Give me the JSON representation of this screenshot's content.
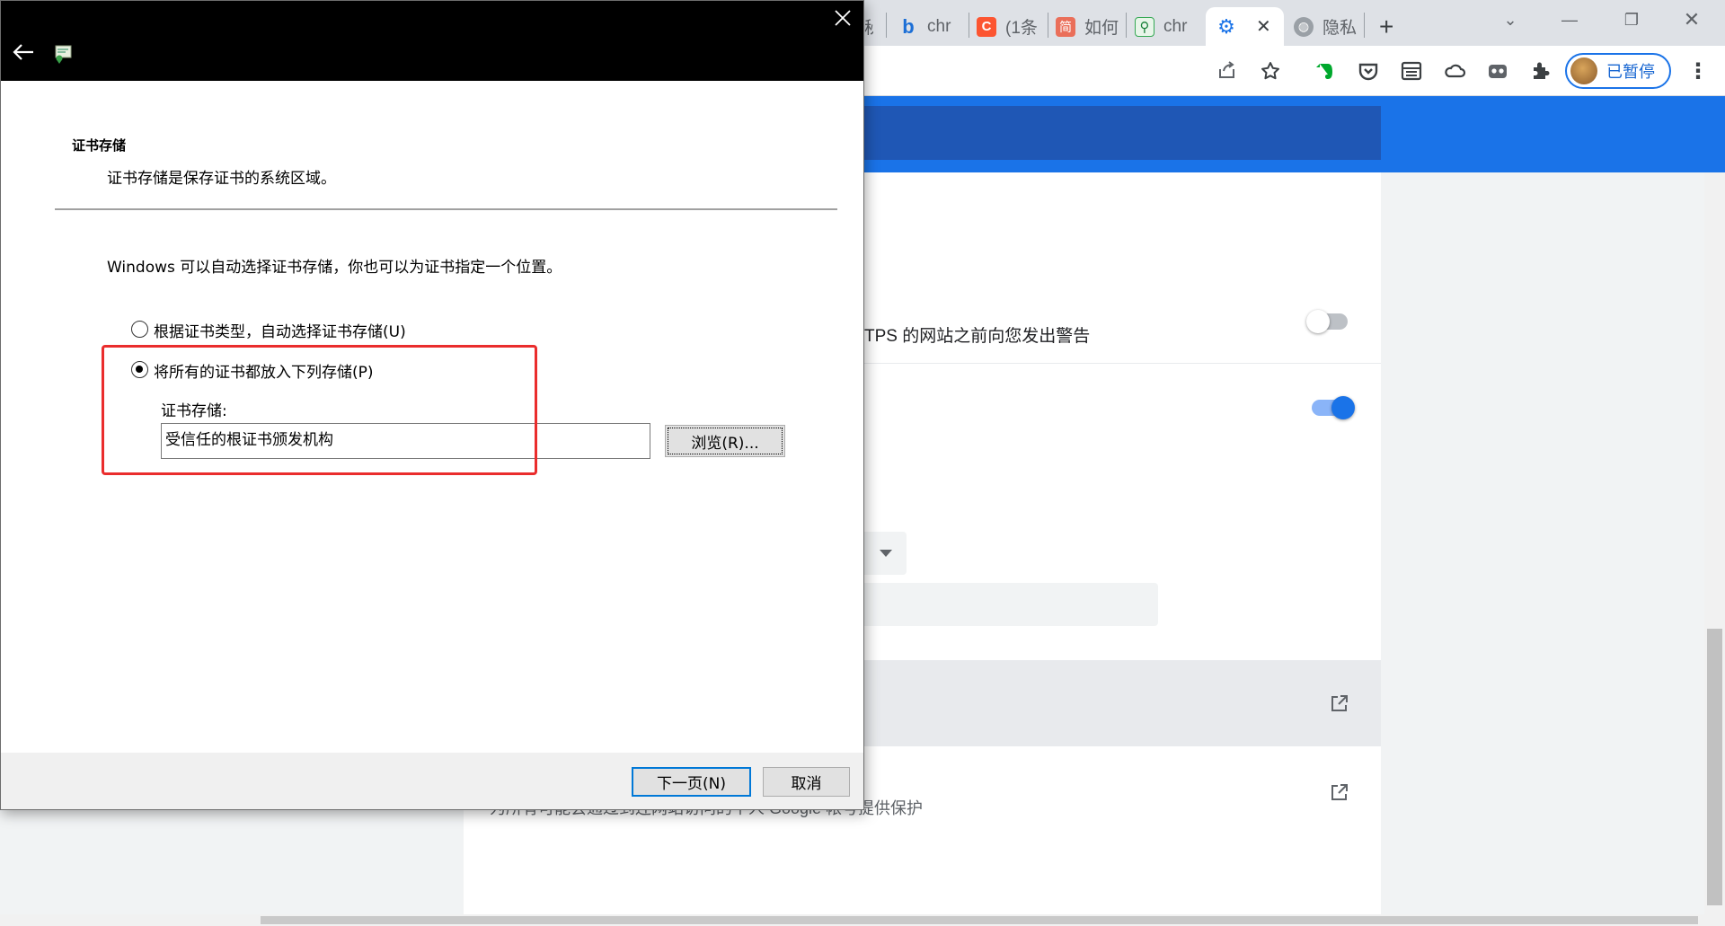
{
  "browser": {
    "tabs": [
      {
        "icon": "bing-icon",
        "label": "chr"
      },
      {
        "icon": "c-icon",
        "label": "(1条"
      },
      {
        "icon": "jian-icon",
        "label": "如何"
      },
      {
        "icon": "maps-icon",
        "label": "chr"
      },
      {
        "icon": "settings-icon",
        "label": ""
      },
      {
        "icon": "globe-icon",
        "label": "隐私"
      }
    ],
    "partial_tab_text": "秘",
    "profile_label": "已暂停",
    "settings_rows": {
      "https_warning_text": "TPS 的网站之前向您发出警告",
      "google_protection_text": "为所有可能会通过到连网站访问的个人 Google 帐号提供保护"
    }
  },
  "wizard": {
    "heading": "证书存储",
    "subheading": "证书存储是保存证书的系统区域。",
    "description": "Windows 可以自动选择证书存储，你也可以为证书指定一个位置。",
    "option_auto": "根据证书类型，自动选择证书存储(U)",
    "option_manual": "将所有的证书都放入下列存储(P)",
    "store_label": "证书存储:",
    "store_value": "受信任的根证书颁发机构",
    "browse_label": "浏览(R)...",
    "next_label": "下一页(N)",
    "cancel_label": "取消"
  },
  "colors": {
    "highlight": "#ea2d2d",
    "chrome_blue": "#1a73e8"
  }
}
